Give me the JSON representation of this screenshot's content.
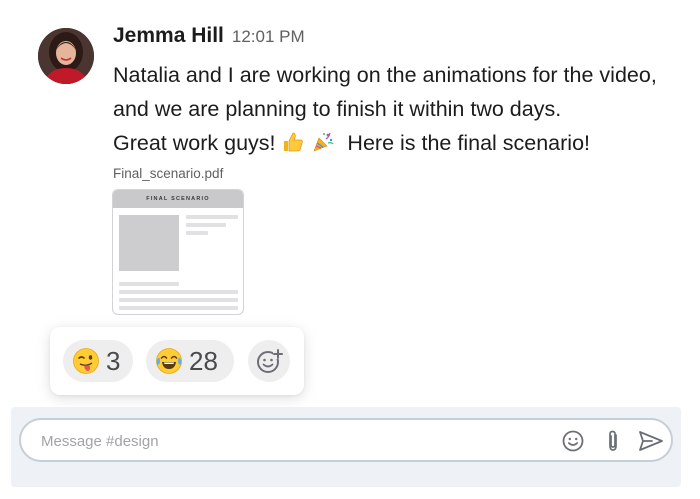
{
  "message": {
    "author": "Jemma Hill",
    "time": "12:01 PM",
    "line1": "Natalia and I are working on the animations for the video,",
    "line2": "and we are planning to finish it within two days.",
    "line3_a": "Great work guys!",
    "line3_b": "Here is the final scenario!",
    "inline_emojis": [
      "thumbs-up",
      "party-popper"
    ]
  },
  "attachment": {
    "file_name": "Final_scenario.pdf",
    "preview_title": "FINAL SCENARIO"
  },
  "reactions": [
    {
      "emoji": "winking-face-with-tongue",
      "count": "3"
    },
    {
      "emoji": "face-with-tears-of-joy",
      "count": "28"
    }
  ],
  "add_reaction_icon": "add-emoji-icon",
  "composer": {
    "placeholder": "Message #design",
    "value": "",
    "icons": [
      "smiley-icon",
      "paperclip-icon",
      "send-icon"
    ]
  },
  "colors": {
    "accent_icon": "#6b6f75",
    "composer_border": "#c7ced6",
    "composer_bg": "#eef2f6"
  }
}
